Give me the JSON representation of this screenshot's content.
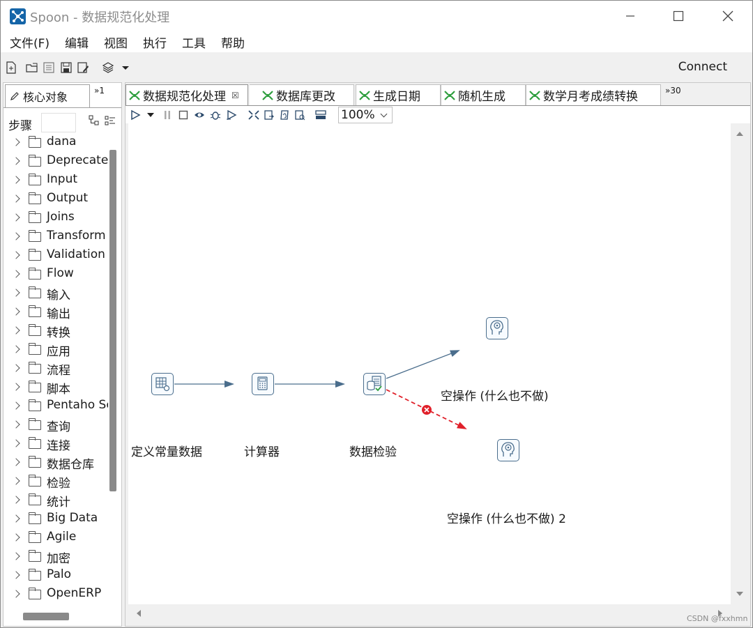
{
  "window": {
    "title": "Spoon - 数据规范化处理"
  },
  "menu": [
    "文件(F)",
    "编辑",
    "视图",
    "执行",
    "工具",
    "帮助"
  ],
  "toolbar": {
    "connect_label": "Connect"
  },
  "left_panel": {
    "tab_label": "核心对象",
    "tab_more": "»1",
    "steps_label": "步骤",
    "tree": [
      "dana",
      "Deprecated",
      "Input",
      "Output",
      "Joins",
      "Transform",
      "Validation",
      "Flow",
      "输入",
      "输出",
      "转换",
      "应用",
      "流程",
      "脚本",
      "Pentaho Server",
      "查询",
      "连接",
      "数据仓库",
      "检验",
      "统计",
      "Big Data",
      "Agile",
      "加密",
      "Palo",
      "OpenERP"
    ]
  },
  "tabs": [
    {
      "label": "数据规范化处理",
      "active": true,
      "close": "☒"
    },
    {
      "label": "数据库更改",
      "active": false
    },
    {
      "label": "生成日期",
      "active": false
    },
    {
      "label": "随机生成",
      "active": false
    },
    {
      "label": "数学月考成绩转换",
      "active": false
    }
  ],
  "tabs_more": "»30",
  "canvas_toolbar": {
    "zoom": "100%"
  },
  "steps": [
    {
      "id": "s1",
      "label": "定义常量数据",
      "icon": "constant-table-icon"
    },
    {
      "id": "s2",
      "label": "计算器",
      "icon": "calculator-icon"
    },
    {
      "id": "s3",
      "label": "数据检验",
      "icon": "data-validator-icon"
    },
    {
      "id": "s4",
      "label": "空操作 (什么也不做)",
      "icon": "dummy-head-icon"
    },
    {
      "id": "s5",
      "label": "空操作 (什么也不做) 2",
      "icon": "dummy-head-icon"
    }
  ],
  "colors": {
    "hop": "#4a6d8c",
    "error_hop": "#e0202a",
    "tab_icon_green": "#2e9e3e",
    "logo_blue": "#1565a8"
  },
  "watermark": "CSDN @fxxhmn"
}
